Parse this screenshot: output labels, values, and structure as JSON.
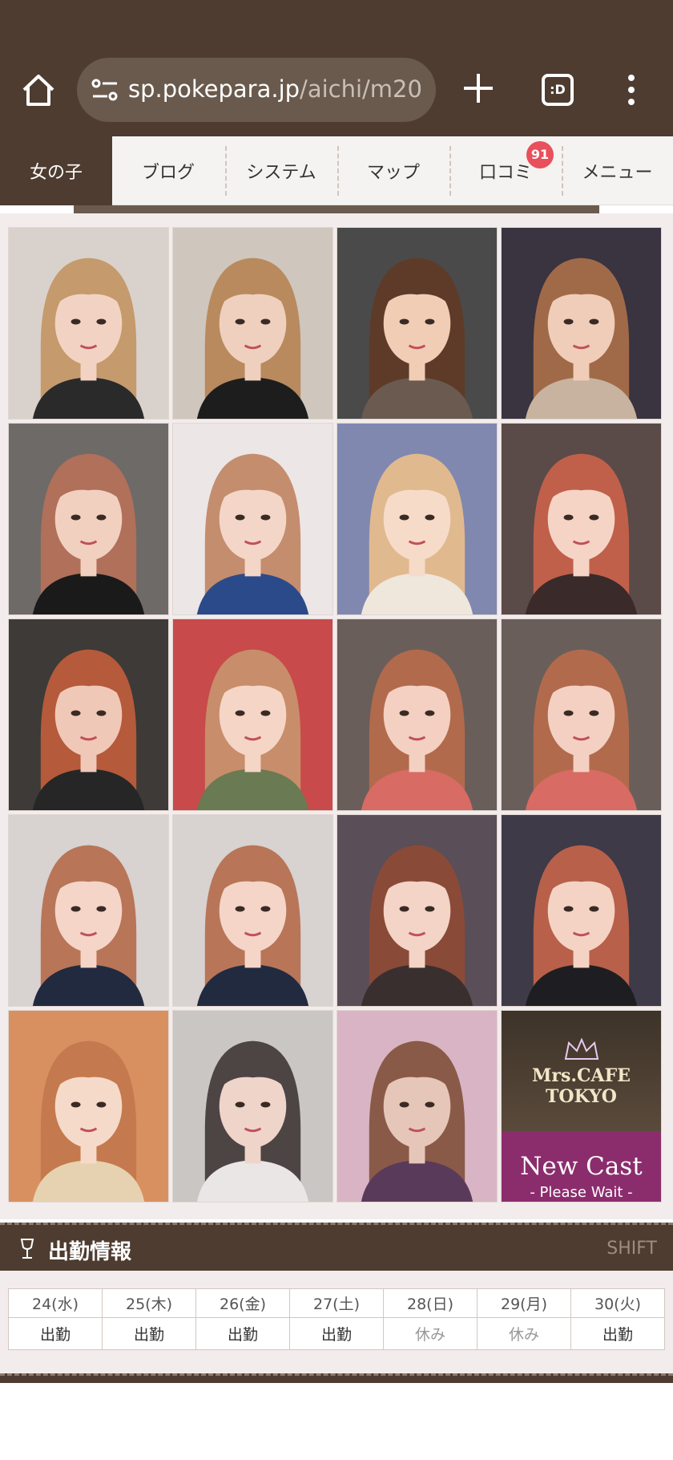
{
  "browser": {
    "url_host": "sp.pokepara.jp",
    "url_path": "/aichi/m20",
    "tabs_label": ":D"
  },
  "nav": {
    "items": [
      {
        "label": "女の子",
        "active": true
      },
      {
        "label": "ブログ"
      },
      {
        "label": "システム"
      },
      {
        "label": "マップ"
      },
      {
        "label": "口コミ",
        "badge": "91"
      },
      {
        "label": "メニュー"
      }
    ]
  },
  "gallery": {
    "photos": [
      {
        "name": "cast-photo-1",
        "bg": "#d9d2cc",
        "hair": "#c59a6c",
        "skin": "#f2d3c3",
        "shirt": "#2a2a2a"
      },
      {
        "name": "cast-photo-2",
        "bg": "#cfc6bd",
        "hair": "#b88a5e",
        "skin": "#efd0be",
        "shirt": "#1d1d1d"
      },
      {
        "name": "cast-photo-3",
        "bg": "#4a4a4a",
        "hair": "#5e3b28",
        "skin": "#f1cdb6",
        "shirt": "#6b5a50"
      },
      {
        "name": "cast-photo-4",
        "bg": "#3a3340",
        "hair": "#a06a48",
        "skin": "#f0cdb9",
        "shirt": "#c7b39f"
      },
      {
        "name": "cast-photo-5",
        "bg": "#6e6a68",
        "hair": "#b0705a",
        "skin": "#f2d0c0",
        "shirt": "#1a1a1a"
      },
      {
        "name": "cast-photo-6",
        "bg": "#ece6e6",
        "hair": "#c48d6e",
        "skin": "#f4d6c8",
        "shirt": "#2b4a8a"
      },
      {
        "name": "cast-photo-7",
        "bg": "#8088b0",
        "hair": "#e0b98e",
        "skin": "#f6dbc9",
        "shirt": "#efe6dc"
      },
      {
        "name": "cast-photo-8",
        "bg": "#5a4a48",
        "hair": "#c0604a",
        "skin": "#f5d4c6",
        "shirt": "#3a2a2a"
      },
      {
        "name": "cast-photo-9",
        "bg": "#3d3a38",
        "hair": "#b55a3a",
        "skin": "#f0c8b8",
        "shirt": "#262626"
      },
      {
        "name": "cast-photo-10",
        "bg": "#c84a4a",
        "hair": "#c88d6a",
        "skin": "#f4d5c6",
        "shirt": "#6a7a52"
      },
      {
        "name": "cast-photo-11",
        "bg": "#6a5e5a",
        "hair": "#b26a4c",
        "skin": "#f3d0c2",
        "shirt": "#d86b63"
      },
      {
        "name": "cast-photo-12",
        "bg": "#6a5e5a",
        "hair": "#b26a4c",
        "skin": "#f3d0c2",
        "shirt": "#d86b63"
      },
      {
        "name": "cast-photo-13",
        "bg": "#d8d2d0",
        "hair": "#b87558",
        "skin": "#f4d5c8",
        "shirt": "#222a40"
      },
      {
        "name": "cast-photo-14",
        "bg": "#d8d2d0",
        "hair": "#b87558",
        "skin": "#f4d5c8",
        "shirt": "#222a40"
      },
      {
        "name": "cast-photo-15",
        "bg": "#5a4e58",
        "hair": "#8a4a38",
        "skin": "#f3d4c6",
        "shirt": "#3a2f2f"
      },
      {
        "name": "cast-photo-16",
        "bg": "#3e3a48",
        "hair": "#b8604a",
        "skin": "#f4d3c5",
        "shirt": "#1e1e22"
      },
      {
        "name": "cast-photo-17",
        "bg": "#d89060",
        "hair": "#c47a4e",
        "skin": "#f6dac9",
        "shirt": "#e6d2b0"
      },
      {
        "name": "cast-photo-18",
        "bg": "#c9c6c4",
        "hair": "#4d4444",
        "skin": "#efd4ca",
        "shirt": "#eae6e6"
      },
      {
        "name": "cast-photo-19",
        "bg": "#d8b4c4",
        "hair": "#8a5a48",
        "skin": "#e6c6b8",
        "shirt": "#5a3a5a"
      }
    ],
    "new_cast_card": {
      "brand_line1": "Mrs.CAFE",
      "brand_line2": "TOKYO",
      "headline": "New Cast",
      "subline": "- Please Wait -"
    }
  },
  "shift": {
    "title": "出勤情報",
    "subtitle": "SHIFT",
    "days": [
      {
        "date": "24(水)",
        "status": "出勤",
        "type": "work",
        "day_type": "weekday"
      },
      {
        "date": "25(木)",
        "status": "出勤",
        "type": "work",
        "day_type": "weekday"
      },
      {
        "date": "26(金)",
        "status": "出勤",
        "type": "work",
        "day_type": "weekday"
      },
      {
        "date": "27(土)",
        "status": "出勤",
        "type": "work",
        "day_type": "sat"
      },
      {
        "date": "28(日)",
        "status": "休み",
        "type": "off",
        "day_type": "sun"
      },
      {
        "date": "29(月)",
        "status": "休み",
        "type": "off",
        "day_type": "weekday"
      },
      {
        "date": "30(火)",
        "status": "出勤",
        "type": "work",
        "day_type": "weekday"
      }
    ]
  },
  "colors": {
    "brand_brown": "#4e3c30",
    "badge_red": "#e8505b",
    "saturday": "#27b7b1",
    "sunday": "#e5738c"
  }
}
